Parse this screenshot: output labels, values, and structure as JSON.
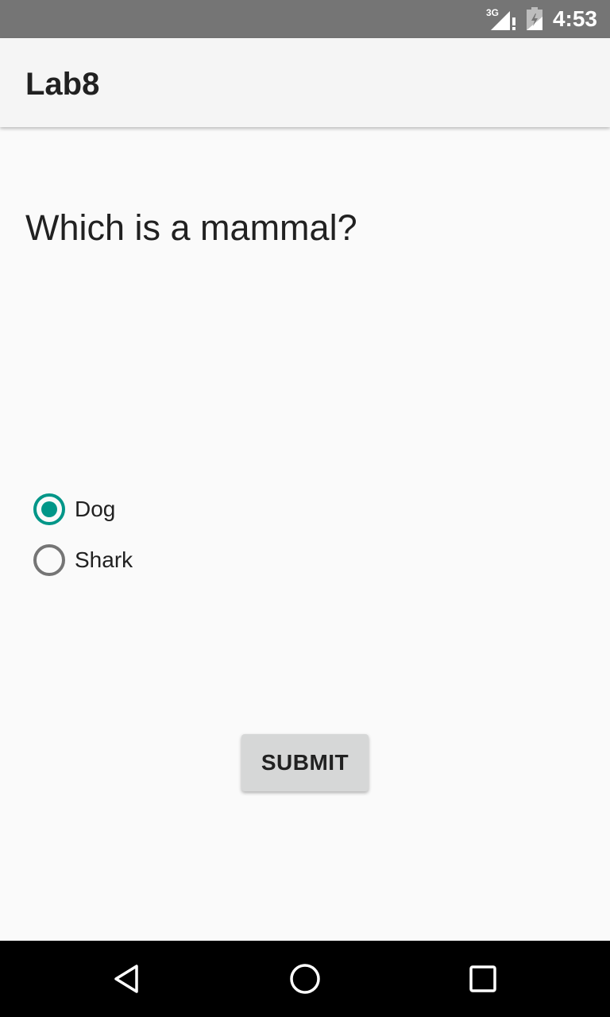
{
  "status_bar": {
    "network": "3G",
    "time": "4:53",
    "icons": [
      "signal-icon",
      "battery-icon"
    ]
  },
  "app_bar": {
    "title": "Lab8"
  },
  "quiz": {
    "question": "Which is a mammal?",
    "options": [
      {
        "label": "Dog",
        "checked": true
      },
      {
        "label": "Shark",
        "checked": false
      }
    ],
    "submit_label": "SUBMIT"
  },
  "nav_bar": {
    "icons": [
      "back-icon",
      "home-icon",
      "recents-icon"
    ]
  },
  "colors": {
    "accent": "#009688",
    "status_bar": "#757575",
    "app_bar": "#f5f5f5",
    "background": "#fafafa",
    "button": "#d6d7d7"
  }
}
